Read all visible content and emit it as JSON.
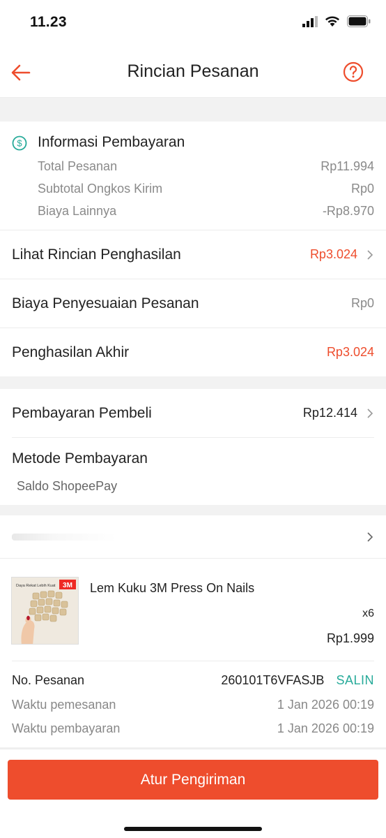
{
  "status_bar": {
    "time": "11.23",
    "icons": [
      "cellular-signal-icon",
      "wifi-icon",
      "battery-icon"
    ]
  },
  "header": {
    "title": "Rincian Pesanan",
    "back_icon": "arrow-left-icon",
    "help_icon": "question-circle-icon"
  },
  "payment_info": {
    "title": "Informasi Pembayaran",
    "icon": "dollar-circle-icon",
    "rows": [
      {
        "label": "Total Pesanan",
        "value": "Rp11.994"
      },
      {
        "label": "Subtotal Ongkos Kirim",
        "value": "Rp0"
      },
      {
        "label": "Biaya Lainnya",
        "value": "-Rp8.970"
      }
    ]
  },
  "income": {
    "details_label": "Lihat Rincian Penghasilan",
    "details_value": "Rp3.024",
    "adjustment_label": "Biaya Penyesuaian Pesanan",
    "adjustment_value": "Rp0",
    "final_label": "Penghasilan Akhir",
    "final_value": "Rp3.024"
  },
  "buyer_payment": {
    "label": "Pembayaran Pembeli",
    "value": "Rp12.414",
    "method_label": "Metode Pembayaran",
    "method_value": "Saldo ShopeePay"
  },
  "product": {
    "name": "Lem Kuku 3M Press On Nails",
    "quantity": "x6",
    "price": "Rp1.999",
    "thumb_caption": "Daya Rekat Lebih Kuat",
    "thumb_brand": "3M"
  },
  "order": {
    "number_label": "No. Pesanan",
    "number_value": "260101T6VFASJB",
    "copy_label": "SALIN",
    "order_time_label": "Waktu pemesanan",
    "order_time_value": "1 Jan 2026 00:19",
    "payment_time_label": "Waktu pembayaran",
    "payment_time_value": "1 Jan 2026 00:19"
  },
  "action": {
    "label": "Atur Pengiriman"
  },
  "colors": {
    "accent": "#ee4d2d",
    "teal": "#26aa99"
  }
}
